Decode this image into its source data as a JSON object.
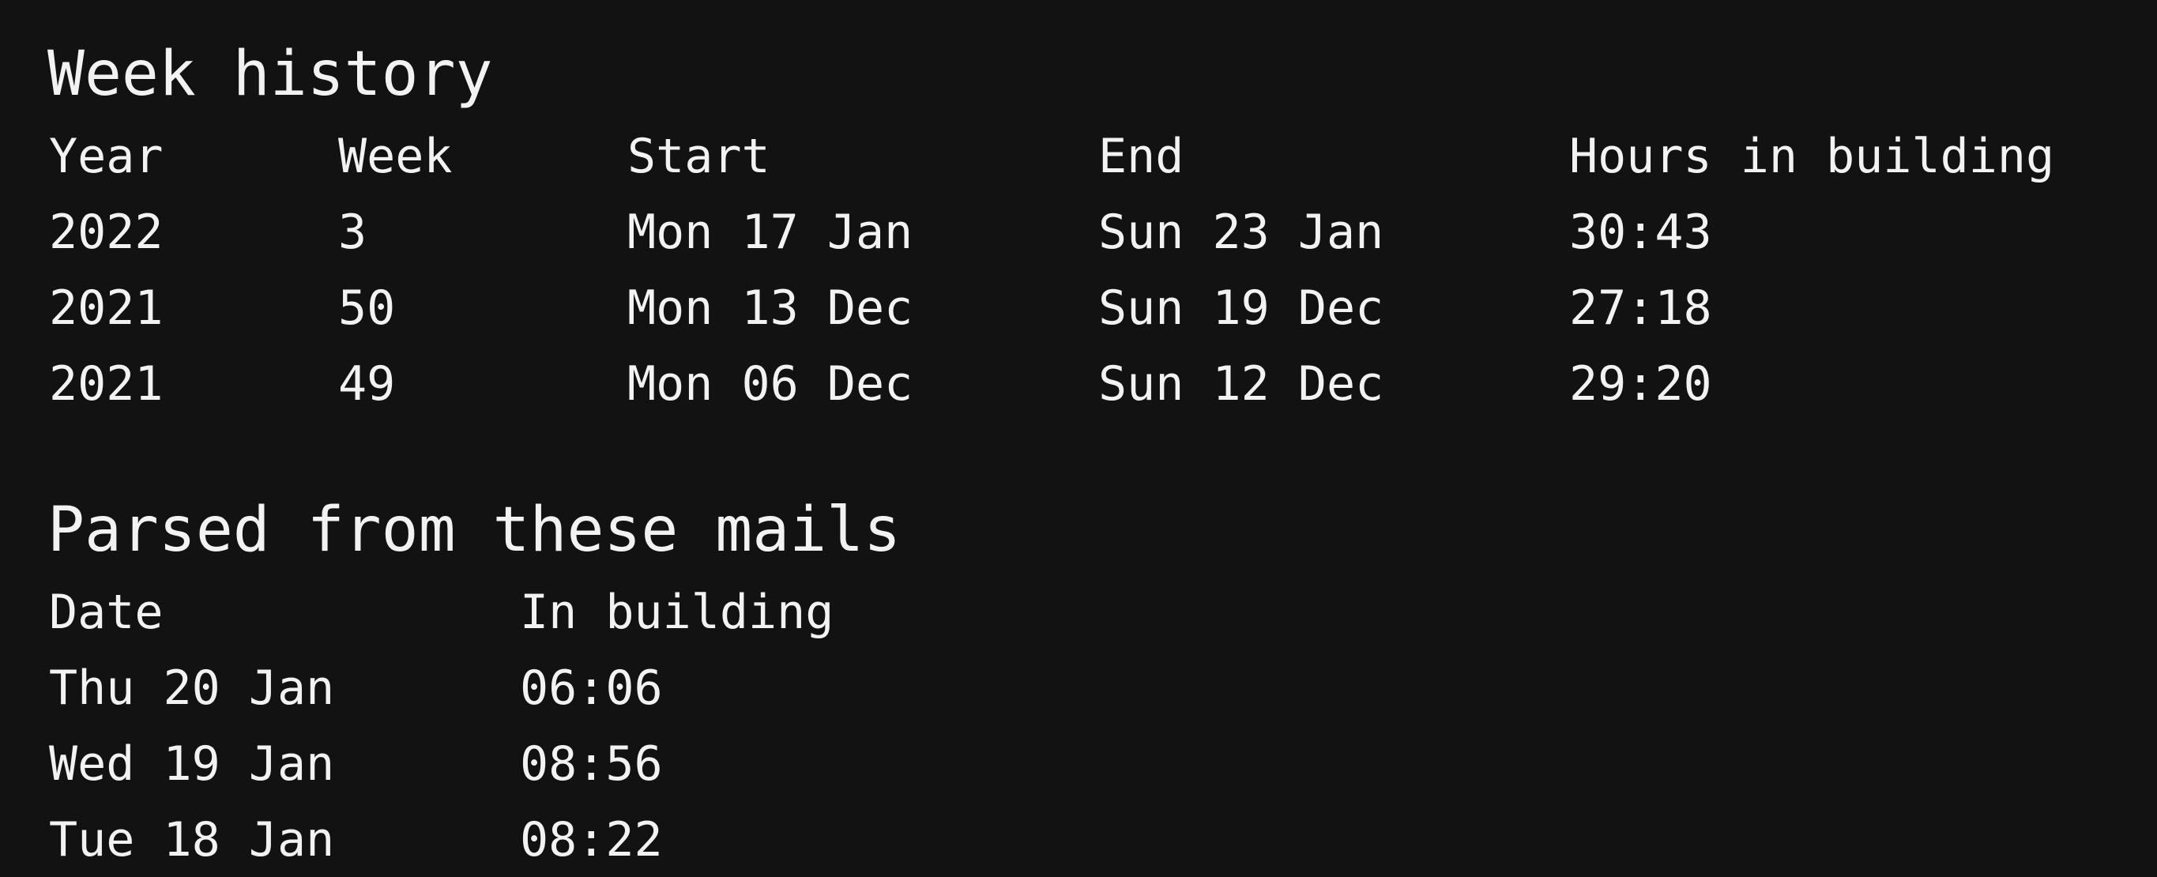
{
  "week_history": {
    "title": "Week history",
    "columns": [
      "Year",
      "Week",
      "Start",
      "End",
      "Hours in building"
    ],
    "rows": [
      [
        "2022",
        "3",
        "Mon 17 Jan",
        "Sun 23 Jan",
        "30:43"
      ],
      [
        "2021",
        "50",
        "Mon 13 Dec",
        "Sun 19 Dec",
        "27:18"
      ],
      [
        "2021",
        "49",
        "Mon 06 Dec",
        "Sun 12 Dec",
        "29:20"
      ]
    ]
  },
  "parsed_mails": {
    "title": "Parsed from these mails",
    "columns": [
      "Date",
      "In building"
    ],
    "rows": [
      [
        "Thu 20 Jan",
        "06:06"
      ],
      [
        "Wed 19 Jan",
        "08:56"
      ],
      [
        "Tue 18 Jan",
        "08:22"
      ]
    ]
  },
  "colors": {
    "background": "#121212",
    "text": "#f2f2f2"
  }
}
